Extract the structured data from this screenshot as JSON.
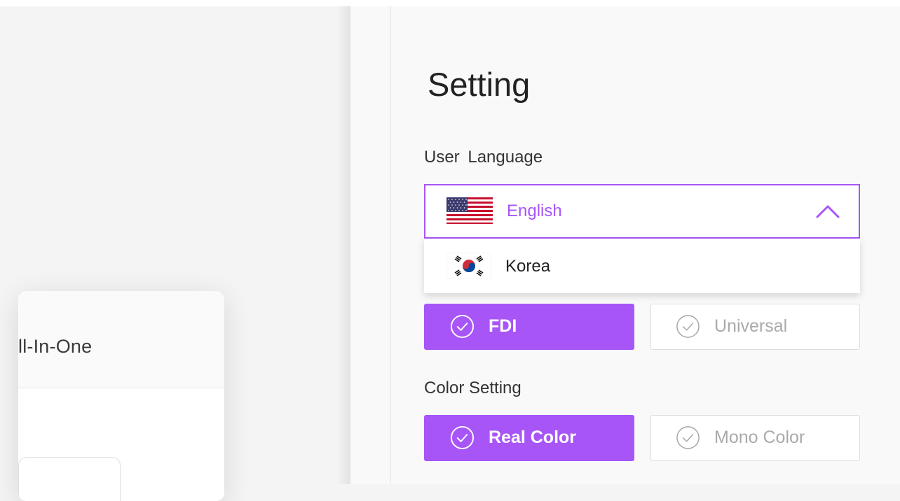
{
  "background": {
    "card_title": "ll-In-One"
  },
  "panel": {
    "title": "Setting",
    "language": {
      "label": "User  Language",
      "selected": "English",
      "selected_flag": "us-flag-icon",
      "options": [
        {
          "label": "Korea",
          "flag": "korea-flag-icon"
        }
      ]
    },
    "tooth_numbering": {
      "options": [
        {
          "label": "FDI",
          "selected": true
        },
        {
          "label": "Universal",
          "selected": false
        }
      ]
    },
    "color_setting": {
      "label": "Color Setting",
      "options": [
        {
          "label": "Real Color",
          "selected": true
        },
        {
          "label": "Mono Color",
          "selected": false
        }
      ]
    }
  },
  "colors": {
    "accent": "#a855f7",
    "option_off_border": "#dcdcdc",
    "option_off_text": "#aaaaaa"
  }
}
